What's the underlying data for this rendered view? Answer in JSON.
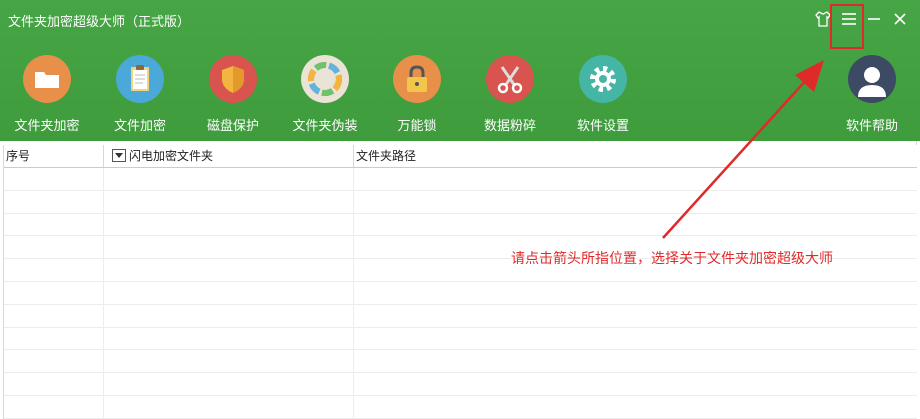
{
  "window": {
    "title": "文件夹加密超级大师（正式版）",
    "controls": [
      "skin-icon",
      "menu-icon",
      "minimize-icon",
      "close-icon"
    ]
  },
  "toolbar": {
    "items": [
      {
        "label": "文件夹加密",
        "icon": "folder-icon",
        "color": "#e8904a"
      },
      {
        "label": "文件加密",
        "icon": "clipboard-icon",
        "color": "#4ba9d9"
      },
      {
        "label": "磁盘保护",
        "icon": "shield-icon",
        "color": "#d9534f"
      },
      {
        "label": "文件夹伪装",
        "icon": "color-wheel-icon",
        "color": "#e9e4d6"
      },
      {
        "label": "万能锁",
        "icon": "lock-icon",
        "color": "#e8904a"
      },
      {
        "label": "数据粉碎",
        "icon": "scissors-icon",
        "color": "#d9534f"
      },
      {
        "label": "软件设置",
        "icon": "gear-icon",
        "color": "#45b5a6"
      },
      {
        "label": "软件帮助",
        "icon": "user-icon",
        "color": "#3d4a63"
      }
    ]
  },
  "table": {
    "columns": [
      "序号",
      "闪电加密文件夹",
      "文件夹路径"
    ],
    "rows": []
  },
  "annotation": {
    "text": "请点击箭头所指位置，选择关于文件夹加密超级大师",
    "color": "#e02a2a"
  },
  "colors": {
    "header_green": "#45a343",
    "accent_red": "#e02a2a"
  }
}
